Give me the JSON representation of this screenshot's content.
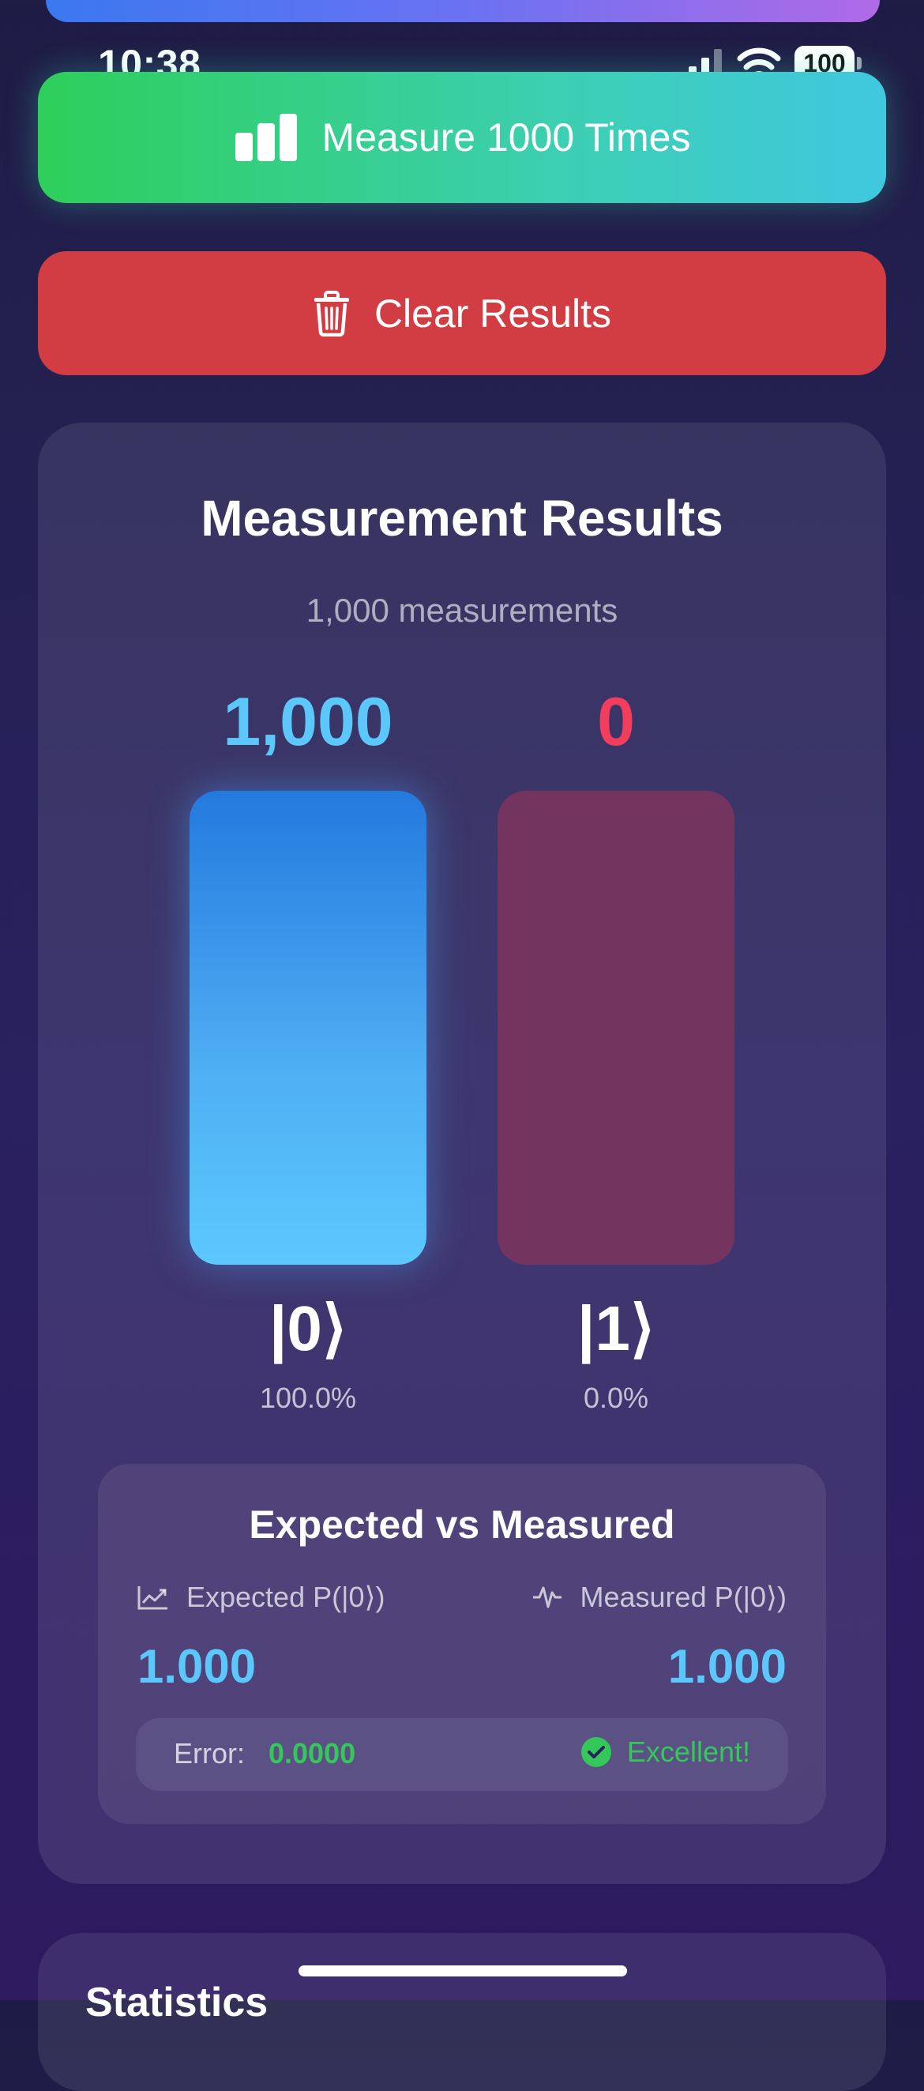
{
  "status_bar": {
    "time": "10:38",
    "battery": "100"
  },
  "actions": {
    "measure_label": "Measure 1000 Times",
    "measure_icon": "chart-bar-icon",
    "clear_label": "Clear Results",
    "clear_icon": "trash-icon"
  },
  "results": {
    "title": "Measurement Results",
    "subtitle": "1,000 measurements",
    "states": [
      {
        "count": "1,000",
        "label": "|0⟩",
        "percent": "100.0%",
        "fraction": 1.0,
        "color": "#5bc7fb"
      },
      {
        "count": "0",
        "label": "|1⟩",
        "percent": "0.0%",
        "fraction": 0.0,
        "color": "#f23d5c"
      }
    ],
    "comparison": {
      "title": "Expected vs Measured",
      "expected_label": "Expected P(|0⟩)",
      "expected_value": "1.000",
      "expected_icon": "chart-line-icon",
      "measured_label": "Measured P(|0⟩)",
      "measured_value": "1.000",
      "measured_icon": "waveform-icon",
      "error_label": "Error:",
      "error_value": "0.0000",
      "status_label": "Excellent!",
      "status_icon": "checkmark-circle-icon"
    }
  },
  "statistics": {
    "title": "Statistics"
  },
  "colors": {
    "accent_blue": "#5bc7fb",
    "accent_red": "#f23d5c",
    "success_green": "#34c759",
    "clear_button": "#d13d42"
  }
}
